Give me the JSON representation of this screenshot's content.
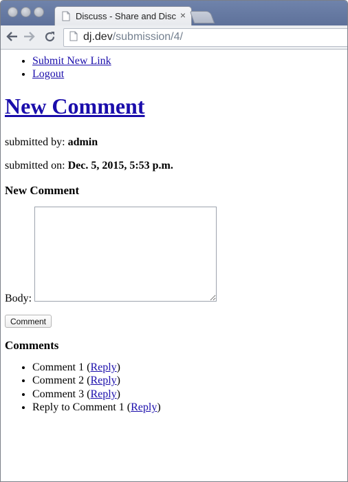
{
  "browser": {
    "tab_title": "Discuss - Share and Discuss",
    "tab_close": "×",
    "url_host": "dj.dev",
    "url_path": "/submission/4/"
  },
  "nav": {
    "submit_link": "Submit New Link",
    "logout": "Logout"
  },
  "page": {
    "title": "New Comment",
    "submitted_by_label": "submitted by:",
    "submitted_by": "admin",
    "submitted_on_label": "submitted on:",
    "submitted_on": "Dec. 5, 2015, 5:53 p.m."
  },
  "form": {
    "heading": "New Comment",
    "body_label": "Body:",
    "body_value": "",
    "submit_label": "Comment"
  },
  "comments": {
    "heading": "Comments",
    "reply_label": "Reply",
    "items": [
      "Comment 1",
      "Comment 2",
      "Comment 3",
      "Reply to Comment 1"
    ]
  }
}
